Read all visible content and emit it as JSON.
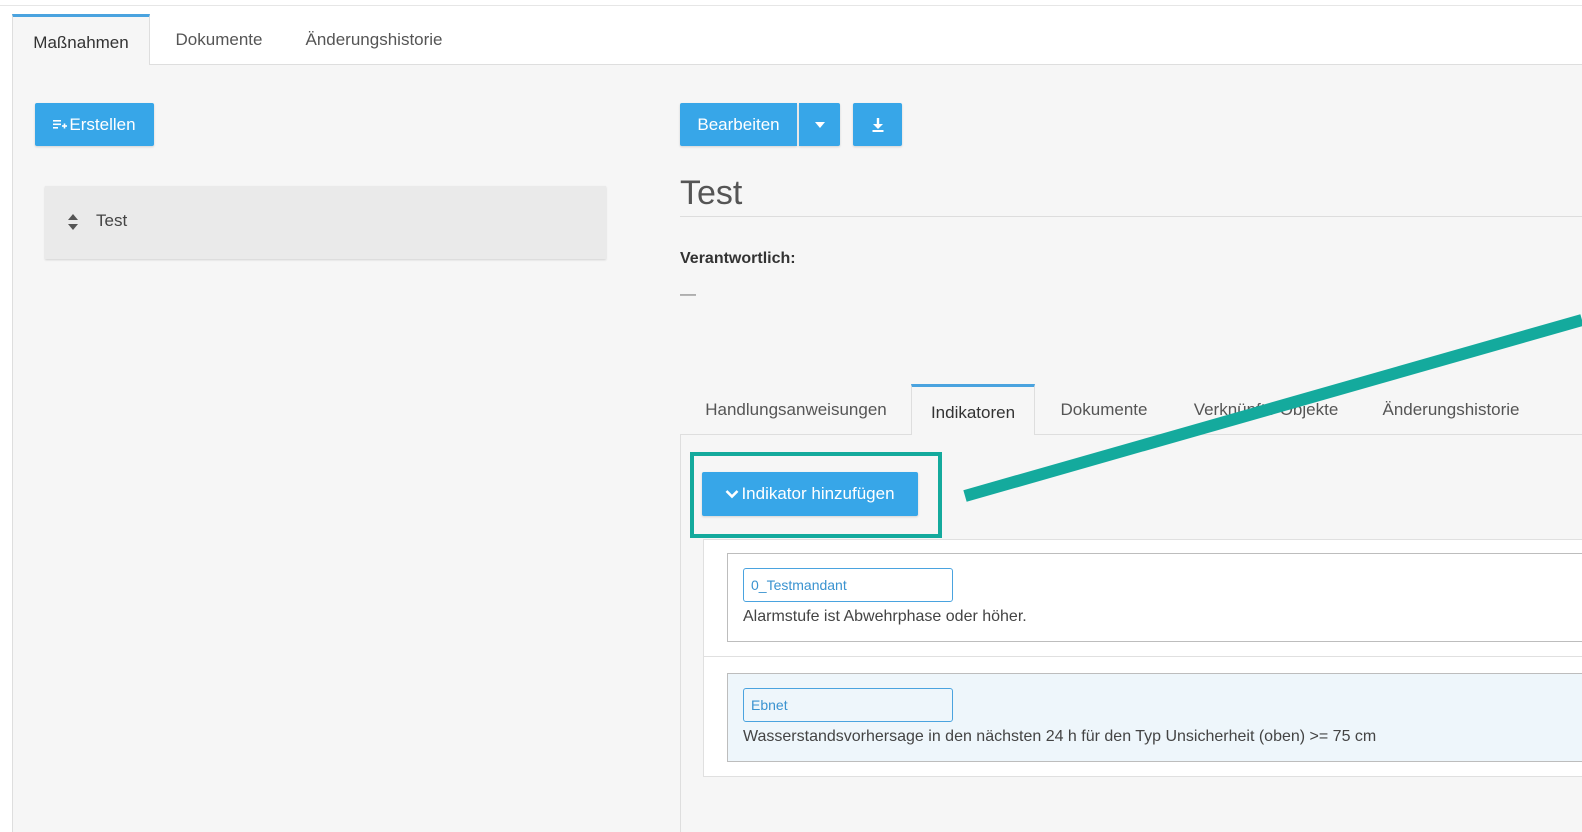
{
  "top_tabs": [
    {
      "label": "Maßnahmen",
      "active": true
    },
    {
      "label": "Dokumente",
      "active": false
    },
    {
      "label": "Änderungshistorie",
      "active": false
    }
  ],
  "left": {
    "create_button_label": "Erstellen",
    "list_items": [
      {
        "label": "Test"
      }
    ]
  },
  "detail": {
    "edit_button_label": "Bearbeiten",
    "title": "Test",
    "responsible_label": "Verantwortlich:",
    "responsible_value": "—",
    "sub_tabs": [
      {
        "label": "Handlungsanweisungen",
        "active": false
      },
      {
        "label": "Indikatoren",
        "active": true
      },
      {
        "label": "Dokumente",
        "active": false
      },
      {
        "label": "Verknüpfte Objekte",
        "active": false
      },
      {
        "label": "Änderungshistorie",
        "active": false
      }
    ],
    "add_indicator_label": "Indikator hinzufügen",
    "indicators": [
      {
        "tag": "0_Testmandant",
        "text": "Alarmstufe ist Abwehrphase oder höher."
      },
      {
        "tag": "Ebnet",
        "text": "Wasserstandsvorhersage in den nächsten 24 h für den Typ Unsicherheit (oben) >= 75 cm"
      }
    ]
  },
  "colors": {
    "accent": "#37a6e8",
    "tab_highlight": "#4aa3df",
    "annotation": "#14aa9d"
  },
  "icons": {
    "create": "list-add-icon",
    "sort": "sort-icon",
    "dropdown": "caret-down-icon",
    "download": "download-icon",
    "add_indicator": "chevron-down-icon"
  }
}
